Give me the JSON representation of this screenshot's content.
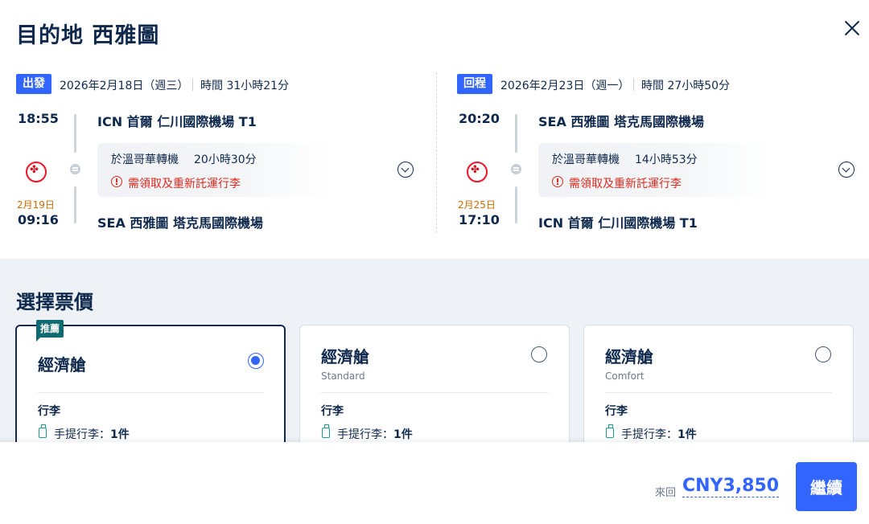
{
  "header": {
    "title": "目的地 西雅圖"
  },
  "outbound": {
    "badge": "出發",
    "date": "2026年2月18日（週三）",
    "duration": "時間 31小時21分",
    "dep_time": "18:55",
    "dep_airport": "ICN 首爾 仁川國際機場 T1",
    "transfer_city": "於溫哥華轉機",
    "transfer_duration": "20小時30分",
    "warning": "需領取及重新託運行李",
    "arr_date": "2月19日",
    "arr_time": "09:16",
    "arr_airport": "SEA 西雅圖 塔克馬國際機場"
  },
  "return": {
    "badge": "回程",
    "date": "2026年2月23日（週一）",
    "duration": "時間 27小時50分",
    "dep_time": "20:20",
    "dep_airport": "SEA 西雅圖 塔克馬國際機場",
    "transfer_city": "於溫哥華轉機",
    "transfer_duration": "14小時53分",
    "warning": "需領取及重新託運行李",
    "arr_date": "2月25日",
    "arr_time": "17:10",
    "arr_airport": "ICN 首爾 仁川國際機場 T1"
  },
  "fares": {
    "title": "選擇票價",
    "cards": [
      {
        "tag": "推薦",
        "name": "經濟艙",
        "subtitle": "",
        "selected": true,
        "luggage_label": "行李",
        "carry_on_label": "手提行李：",
        "carry_on_count": "1件"
      },
      {
        "tag": "",
        "name": "經濟艙",
        "subtitle": "Standard",
        "selected": false,
        "luggage_label": "行李",
        "carry_on_label": "手提行李：",
        "carry_on_count": "1件"
      },
      {
        "tag": "",
        "name": "經濟艙",
        "subtitle": "Comfort",
        "selected": false,
        "luggage_label": "行李",
        "carry_on_label": "手提行李：",
        "carry_on_count": "1件"
      }
    ]
  },
  "footer": {
    "price_label": "來回",
    "price": "CNY3,850",
    "continue_label": "繼續"
  },
  "colors": {
    "accent": "#3264ff",
    "text": "#0f294d",
    "warning": "#e0291f",
    "tag": "#0f6b71",
    "arrival_date": "#d16a00",
    "fare_bg": "#eef1f6"
  },
  "icons": {
    "close": "close-icon",
    "airline": "maple-leaf-icon",
    "expand": "chevron-down-icon",
    "warning": "exclamation-circle-icon",
    "bag": "carry-on-bag-icon"
  }
}
